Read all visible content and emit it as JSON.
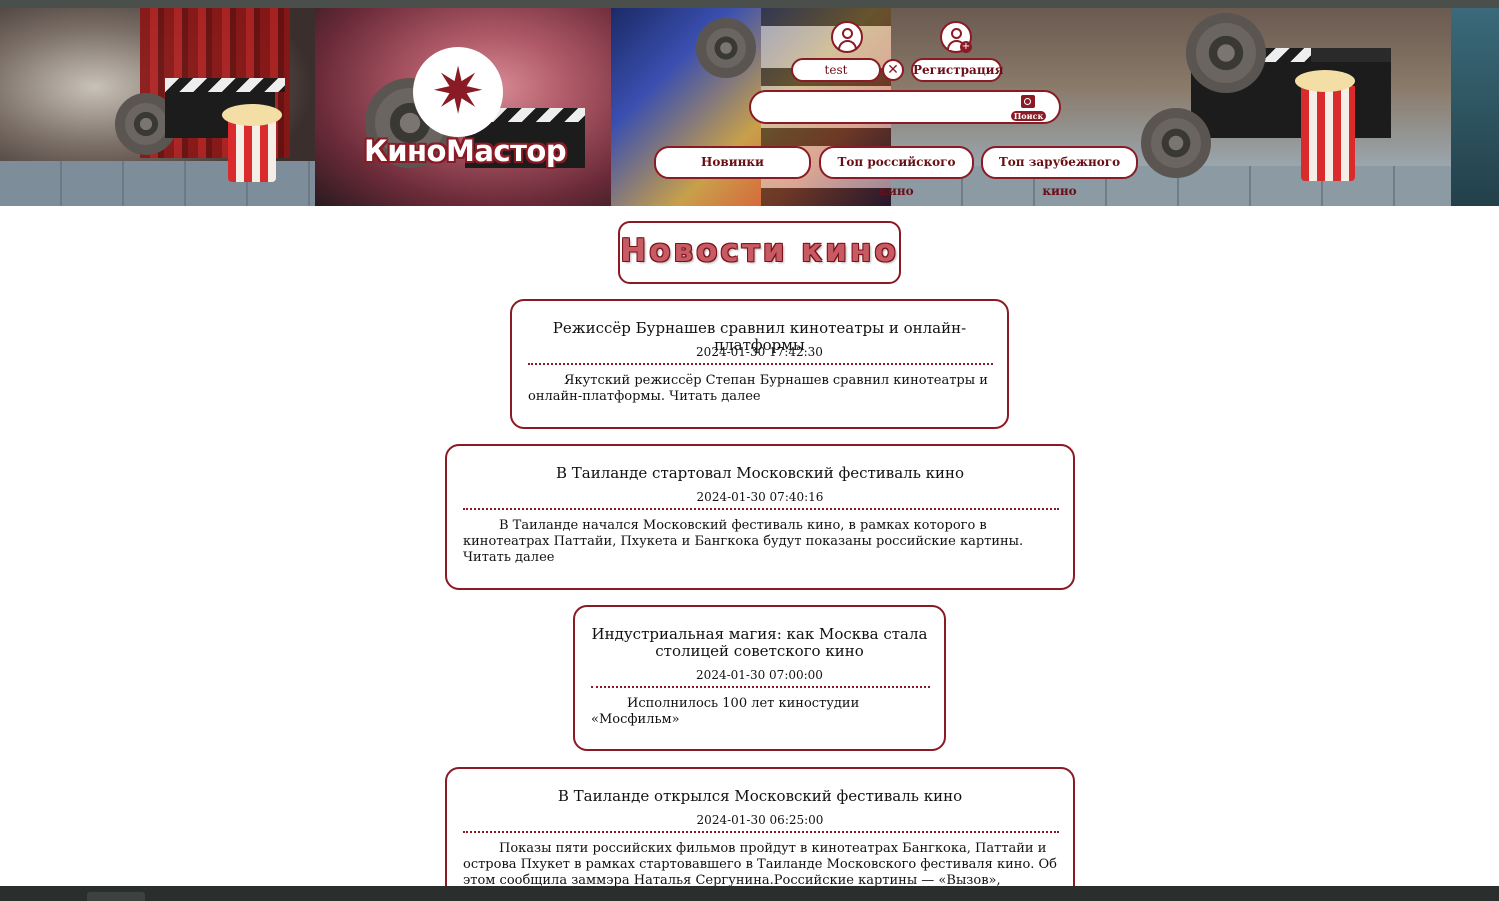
{
  "header": {
    "logo_text": "КиноМастор",
    "user": {
      "username": "test",
      "register_label": "Регистрация"
    },
    "search": {
      "value": "",
      "placeholder": "",
      "button_label": "Поиск"
    },
    "nav": [
      {
        "label": "Новинки"
      },
      {
        "label": "Топ российского кино"
      },
      {
        "label": "Топ зарубежного кино"
      }
    ]
  },
  "main": {
    "page_title": "Новости кино",
    "news": [
      {
        "title": "Режиссёр Бурнашев сравнил кинотеатры и онлайн-платформы",
        "date": "2024-01-30 17:42:30",
        "text": "Якутский режиссёр Степан Бурнашев сравнил кинотеатры и онлайн-платформы.",
        "more": "Читать далее"
      },
      {
        "title": "В Таиланде стартовал Московский фестиваль кино",
        "date": "2024-01-30 07:40:16",
        "text": "В Таиланде начался Московский фестиваль кино, в рамках которого в кинотеатрах Паттайи, Пхукета и Бангкока будут показаны российские картины.",
        "more": "Читать далее"
      },
      {
        "title": "Индустриальная магия: как Москва стала столицей советского кино",
        "date": "2024-01-30 07:00:00",
        "text": "Исполнилось 100 лет киностудии «Мосфильм»",
        "more": ""
      },
      {
        "title": "В Таиланде открылся Московский фестиваль кино",
        "date": "2024-01-30 06:25:00",
        "text": "Показы пяти российских фильмов пройдут в кинотеатрах Бангкока, Паттайи и острова Пхукет в рамках стартовавшего в Таиланде Московского фестиваля кино. Об этом сообщила заммэра Наталья Сергунина.Российские картины — «Вызов», «Сердце",
        "more": ""
      }
    ]
  },
  "colors": {
    "accent": "#8a1a24",
    "background": "#ffffff"
  }
}
